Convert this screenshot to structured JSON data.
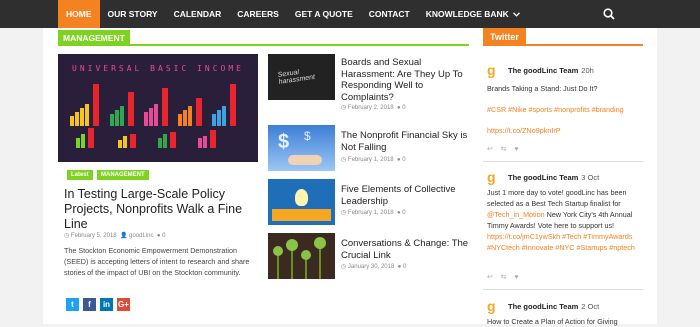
{
  "nav": {
    "items": [
      {
        "label": "HOME",
        "active": true
      },
      {
        "label": "OUR STORY",
        "active": false
      },
      {
        "label": "CALENDAR",
        "active": false
      },
      {
        "label": "CAREERS",
        "active": false
      },
      {
        "label": "GET A QUOTE",
        "active": false
      },
      {
        "label": "CONTACT",
        "active": false
      },
      {
        "label": "KNOWLEDGE BANK",
        "active": false,
        "has_dropdown": true
      }
    ],
    "search_icon": "search-icon",
    "accent": "#f58220"
  },
  "section": {
    "title": "MANAGEMENT",
    "color": "#7ed321"
  },
  "featured": {
    "image_text": "UNIVERSAL BASIC INCOME",
    "tags": [
      "Latest",
      "MANAGEMENT"
    ],
    "title": "In Testing Large-Scale Policy Projects, Nonprofits Walk a Fine Line",
    "date": "February 5, 2018",
    "author": "goodLinc",
    "comments": "0",
    "excerpt": "The Stockton Economic Empowerment Demonstration (SEED) is accepting letters of intent to research and share stories of the impact of UBI on the Stockton community.",
    "social": [
      "twitter-icon",
      "facebook-icon",
      "linkedin-icon",
      "google-plus-icon"
    ]
  },
  "articles": [
    {
      "title": "Boards and Sexual Harassment: Are They Up To Responding Well to Complaints?",
      "date": "February 2, 2018",
      "comments": "0",
      "image_text": "Sexual harassment"
    },
    {
      "title": "The Nonprofit Financial Sky is Not Falling",
      "date": "February 1, 2018",
      "comments": "0",
      "image_text": ""
    },
    {
      "title": "Five Elements of Collective Leadership",
      "date": "February 1, 2018",
      "comments": "0",
      "image_text": ""
    },
    {
      "title": "Conversations & Change: The Crucial Link",
      "date": "January 30, 2018",
      "comments": "0",
      "image_text": ""
    }
  ],
  "twitter": {
    "title": "Twitter",
    "tweets": [
      {
        "name": "The goodLinc Team",
        "time": "20h",
        "text": "Brands Taking a Stand: Just Do It?",
        "hashtags": "#CSR #Nike #sports #nonprofits #branding",
        "link": "https://t.co/ZNo9pknIrP"
      },
      {
        "name": "The goodLinc Team",
        "time": "3 Oct",
        "text_a": "Just 1 more day to vote! goodLinc has been selected as a Best Tech Startup finalist for",
        "mention": "@Tech_in_Motion",
        "text_b": "New York City's 4th Annual Timmy Awards! Vote here to support us!",
        "link": "https://t.co/jmC1ywSkh",
        "hashtags_a": "#Tech #TimmyAwards #NYCtech #Innovate #NYC",
        "hashtags_b": "#Startups #nptech"
      },
      {
        "name": "The goodLinc Team",
        "time": "2 Oct",
        "text": "How to Create a Plan of Action for Giving"
      }
    ]
  }
}
